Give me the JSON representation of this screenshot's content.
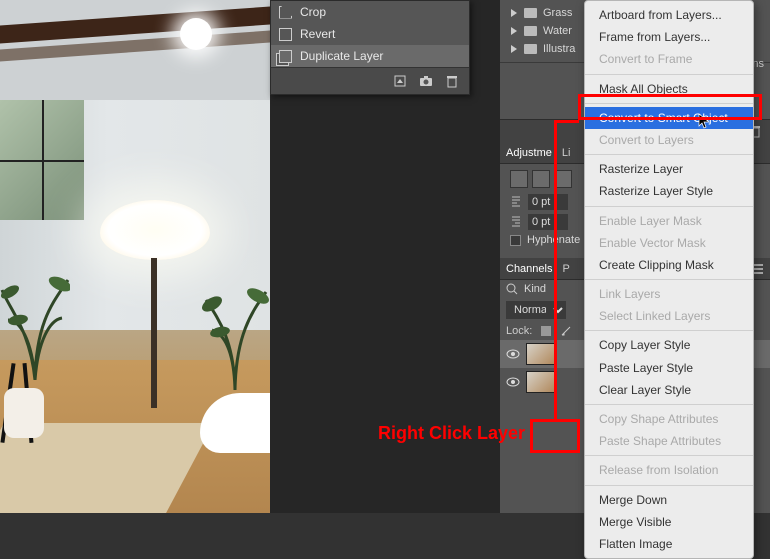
{
  "annotation": {
    "text": "Right Click Layer"
  },
  "top_menu": {
    "items": [
      {
        "label": "Crop",
        "icon": "crop-icon"
      },
      {
        "label": "Revert",
        "icon": "revert-icon"
      },
      {
        "label": "Duplicate Layer",
        "icon": "duplicate-icon",
        "selected": true
      }
    ]
  },
  "libraries_panel": {
    "folders": [
      {
        "label": "Grass"
      },
      {
        "label": "Water"
      },
      {
        "label": "Illustra"
      }
    ],
    "partial_suffix": "rns"
  },
  "adjustments_panel": {
    "tab1": "Adjustme",
    "tab2": "Li"
  },
  "paragraph_panel": {
    "value1": "0 pt",
    "value2": "0 pt",
    "hyphenate": "Hyphenate"
  },
  "channels_panel": {
    "tab": "Channels",
    "tab2": "P"
  },
  "layers_panel": {
    "kind": "Kind",
    "blend": "Normal",
    "lock": "Lock:",
    "search_placeholder": ""
  },
  "context_menu": {
    "items": [
      {
        "label": "Artboard from Layers...",
        "enabled": true
      },
      {
        "label": "Frame from Layers...",
        "enabled": true
      },
      {
        "label": "Convert to Frame",
        "enabled": false
      },
      "sep",
      {
        "label": "Mask All Objects",
        "enabled": true
      },
      "sep",
      {
        "label": "Convert to Smart Object",
        "enabled": true,
        "highlight": true
      },
      {
        "label": "Convert to Layers",
        "enabled": false
      },
      "sep",
      {
        "label": "Rasterize Layer",
        "enabled": true
      },
      {
        "label": "Rasterize Layer Style",
        "enabled": true
      },
      "sep",
      {
        "label": "Enable Layer Mask",
        "enabled": false
      },
      {
        "label": "Enable Vector Mask",
        "enabled": false
      },
      {
        "label": "Create Clipping Mask",
        "enabled": true
      },
      "sep",
      {
        "label": "Link Layers",
        "enabled": false
      },
      {
        "label": "Select Linked Layers",
        "enabled": false
      },
      "sep",
      {
        "label": "Copy Layer Style",
        "enabled": true
      },
      {
        "label": "Paste Layer Style",
        "enabled": true
      },
      {
        "label": "Clear Layer Style",
        "enabled": true
      },
      "sep",
      {
        "label": "Copy Shape Attributes",
        "enabled": false
      },
      {
        "label": "Paste Shape Attributes",
        "enabled": false
      },
      "sep",
      {
        "label": "Release from Isolation",
        "enabled": false
      },
      "sep",
      {
        "label": "Merge Down",
        "enabled": true
      },
      {
        "label": "Merge Visible",
        "enabled": true
      },
      {
        "label": "Flatten Image",
        "enabled": true
      }
    ]
  }
}
